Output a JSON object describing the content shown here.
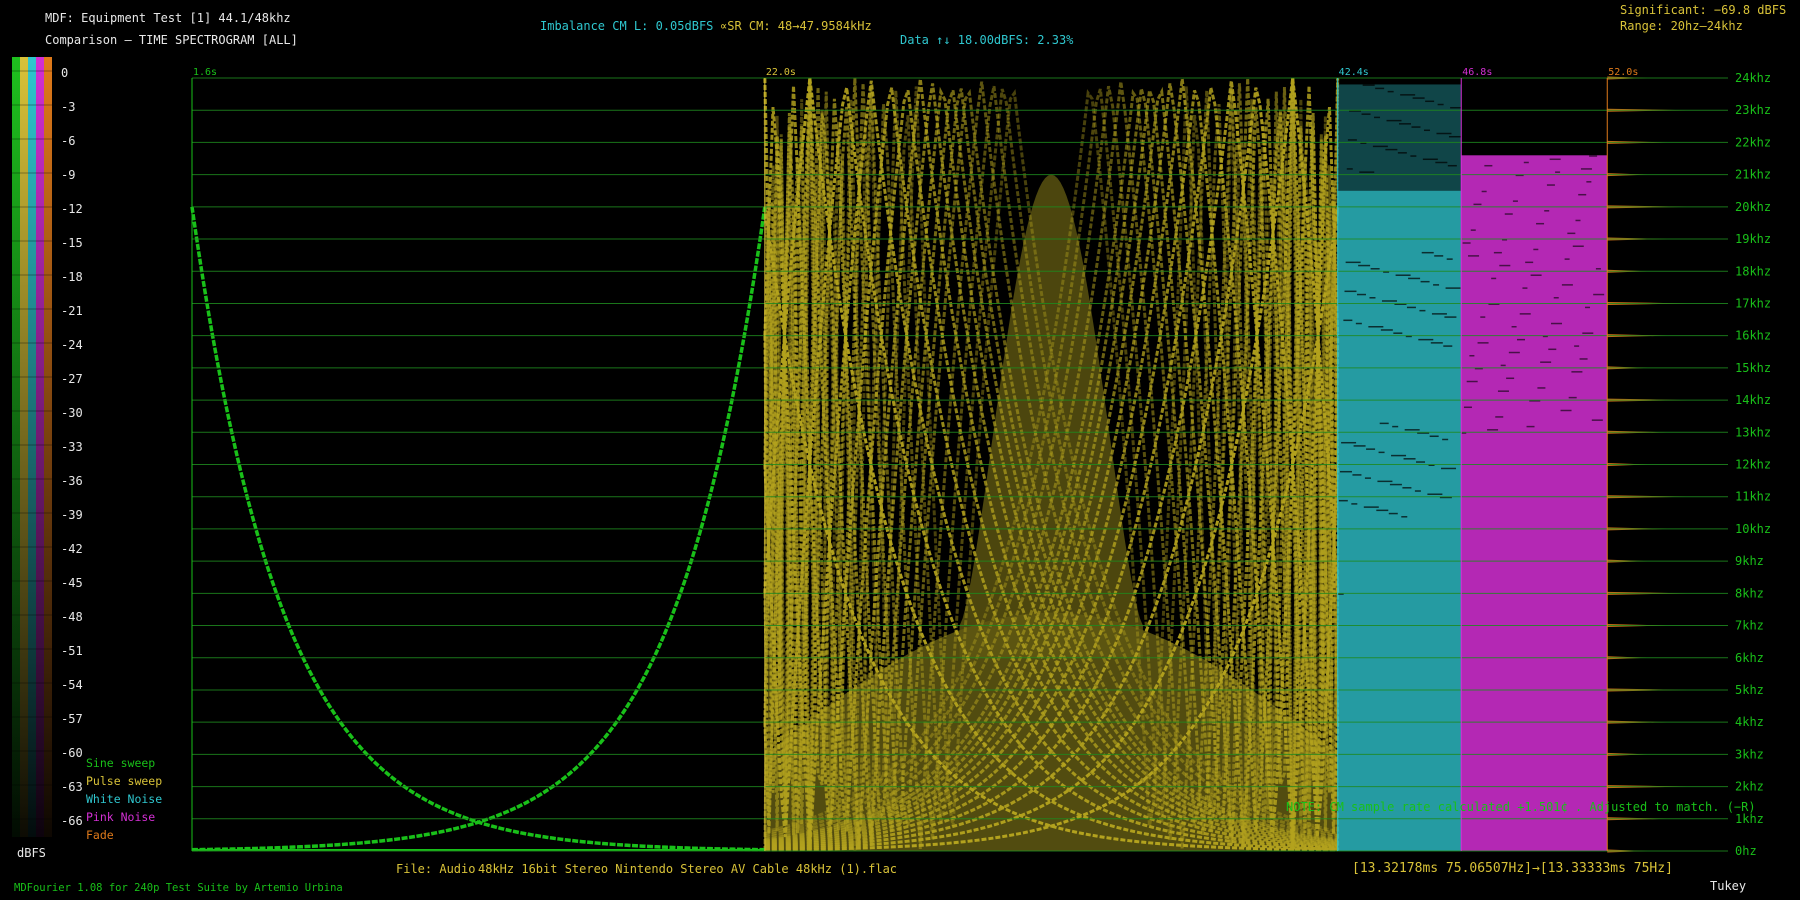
{
  "header": {
    "title_line1": "MDF: Equipment Test [1] 44.1/48khz",
    "title_line2": "Comparison – TIME SPECTROGRAM [ALL]",
    "imbalance": "Imbalance CM L: 0.05dBFS",
    "sample_rate": "∝SR CM: 48→47.9584kHz",
    "data_stat": "Data ↑↓ 18.00dBFS: 2.33%",
    "significant": "Significant: −69.8 dBFS",
    "range": "Range: 20hz–24khz"
  },
  "footer": {
    "file_label": "File: Audio",
    "file_name": "48kHz 16bit Stereo Nintendo Stereo AV Cable 48kHz (1).flac",
    "frame_info": "[13.32178ms 75.06507Hz]→[13.33333ms 75Hz]",
    "credits": "MDFourier 1.08 for 240p Test Suite by Artemio Urbina",
    "window": "Tukey",
    "note": "NOTE: CM sample rate calculated +1.501¢ . Adjusted to match. (−R)"
  },
  "colorbar": {
    "unit": "dBFS",
    "ticks": [
      "0",
      "-3",
      "-6",
      "-9",
      "-12",
      "-15",
      "-18",
      "-21",
      "-24",
      "-27",
      "-30",
      "-33",
      "-36",
      "-39",
      "-42",
      "-45",
      "-48",
      "-51",
      "-54",
      "-57",
      "-60",
      "-63",
      "-66"
    ],
    "stripes": [
      "#1ec01e",
      "#d8c238",
      "#2fc7cf",
      "#d42fd4",
      "#e07a1a"
    ]
  },
  "legend": [
    {
      "label": "Sine sweep",
      "color": "#19c019"
    },
    {
      "label": "Pulse sweep",
      "color": "#d8c238"
    },
    {
      "label": "White Noise",
      "color": "#2fc7cf"
    },
    {
      "label": "Pink Noise",
      "color": "#d42fd4"
    },
    {
      "label": "Fade",
      "color": "#e07a1a"
    }
  ],
  "chart_data": {
    "type": "heatmap",
    "title": "TIME SPECTROGRAM [ALL]",
    "xlabel": "",
    "ylabel": "",
    "ylim": [
      0,
      24
    ],
    "y_ticks": [
      "0hz",
      "1khz",
      "2khz",
      "3khz",
      "4khz",
      "5khz",
      "6khz",
      "7khz",
      "8khz",
      "9khz",
      "10khz",
      "11khz",
      "12khz",
      "13khz",
      "14khz",
      "15khz",
      "16khz",
      "17khz",
      "18khz",
      "19khz",
      "20khz",
      "21khz",
      "22khz",
      "23khz",
      "24khz"
    ],
    "segments": [
      {
        "name": "Sine sweep",
        "start": "1.6s",
        "start_s": 1.6,
        "end_s": 22.0,
        "color": "#19c019"
      },
      {
        "name": "Pulse sweep",
        "start": "22.0s",
        "start_s": 22.0,
        "end_s": 42.4,
        "color": "#d8c238"
      },
      {
        "name": "White Noise",
        "start": "42.4s",
        "start_s": 42.4,
        "end_s": 46.8,
        "color": "#2fc7cf"
      },
      {
        "name": "Pink Noise",
        "start": "46.8s",
        "start_s": 46.8,
        "end_s": 52.0,
        "color": "#d42fd4"
      },
      {
        "name": "Fade",
        "start": "52.0s",
        "start_s": 52.0,
        "end_s": 56.3,
        "color": "#e07a1a"
      }
    ],
    "grid": true,
    "legend_position": "bottom-left"
  }
}
